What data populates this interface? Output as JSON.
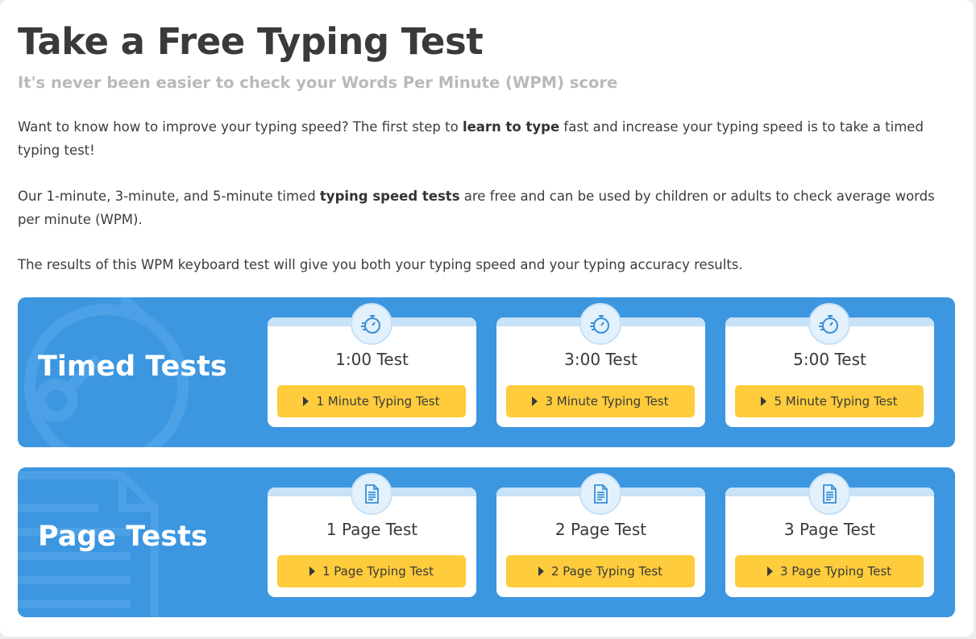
{
  "header": {
    "title": "Take a Free Typing Test",
    "subtitle": "It's never been easier to check your Words Per Minute (WPM) score"
  },
  "intro": {
    "p1_before": "Want to know how to improve your typing speed? The first step to ",
    "p1_bold": "learn to type",
    "p1_after": " fast and increase your typing speed is to take a timed typing test!",
    "p2_before": "Our 1-minute, 3-minute, and 5-minute timed ",
    "p2_bold": "typing speed tests",
    "p2_after": " are free and can be used by children or adults to check average words per minute (WPM).",
    "p3": "The results of this WPM keyboard test will give you both your typing speed and your typing accuracy results."
  },
  "timed": {
    "title": "Timed Tests",
    "cards": [
      {
        "label": "1:00 Test",
        "button": "1 Minute Typing Test"
      },
      {
        "label": "3:00 Test",
        "button": "3 Minute Typing Test"
      },
      {
        "label": "5:00 Test",
        "button": "5 Minute Typing Test"
      }
    ]
  },
  "page": {
    "title": "Page Tests",
    "cards": [
      {
        "label": "1 Page Test",
        "button": "1 Page Typing Test"
      },
      {
        "label": "2 Page Test",
        "button": "2 Page Typing Test"
      },
      {
        "label": "3 Page Test",
        "button": "3 Page Typing Test"
      }
    ]
  },
  "icons": {
    "timed_card": "stopwatch-icon",
    "page_card": "document-icon",
    "button": "play-icon"
  },
  "colors": {
    "band": "#3c96e0",
    "button": "#fecc3c",
    "card_strip": "#c8e2f7",
    "subtitle": "#b9b9b9"
  }
}
